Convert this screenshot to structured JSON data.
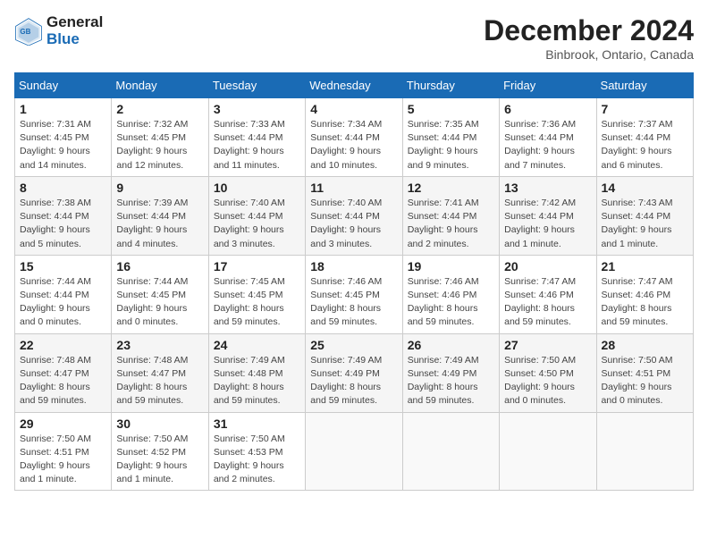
{
  "header": {
    "logo_line1": "General",
    "logo_line2": "Blue",
    "month_title": "December 2024",
    "location": "Binbrook, Ontario, Canada"
  },
  "days_of_week": [
    "Sunday",
    "Monday",
    "Tuesday",
    "Wednesday",
    "Thursday",
    "Friday",
    "Saturday"
  ],
  "weeks": [
    [
      {
        "day": "1",
        "info": "Sunrise: 7:31 AM\nSunset: 4:45 PM\nDaylight: 9 hours and 14 minutes."
      },
      {
        "day": "2",
        "info": "Sunrise: 7:32 AM\nSunset: 4:45 PM\nDaylight: 9 hours and 12 minutes."
      },
      {
        "day": "3",
        "info": "Sunrise: 7:33 AM\nSunset: 4:44 PM\nDaylight: 9 hours and 11 minutes."
      },
      {
        "day": "4",
        "info": "Sunrise: 7:34 AM\nSunset: 4:44 PM\nDaylight: 9 hours and 10 minutes."
      },
      {
        "day": "5",
        "info": "Sunrise: 7:35 AM\nSunset: 4:44 PM\nDaylight: 9 hours and 9 minutes."
      },
      {
        "day": "6",
        "info": "Sunrise: 7:36 AM\nSunset: 4:44 PM\nDaylight: 9 hours and 7 minutes."
      },
      {
        "day": "7",
        "info": "Sunrise: 7:37 AM\nSunset: 4:44 PM\nDaylight: 9 hours and 6 minutes."
      }
    ],
    [
      {
        "day": "8",
        "info": "Sunrise: 7:38 AM\nSunset: 4:44 PM\nDaylight: 9 hours and 5 minutes."
      },
      {
        "day": "9",
        "info": "Sunrise: 7:39 AM\nSunset: 4:44 PM\nDaylight: 9 hours and 4 minutes."
      },
      {
        "day": "10",
        "info": "Sunrise: 7:40 AM\nSunset: 4:44 PM\nDaylight: 9 hours and 3 minutes."
      },
      {
        "day": "11",
        "info": "Sunrise: 7:40 AM\nSunset: 4:44 PM\nDaylight: 9 hours and 3 minutes."
      },
      {
        "day": "12",
        "info": "Sunrise: 7:41 AM\nSunset: 4:44 PM\nDaylight: 9 hours and 2 minutes."
      },
      {
        "day": "13",
        "info": "Sunrise: 7:42 AM\nSunset: 4:44 PM\nDaylight: 9 hours and 1 minute."
      },
      {
        "day": "14",
        "info": "Sunrise: 7:43 AM\nSunset: 4:44 PM\nDaylight: 9 hours and 1 minute."
      }
    ],
    [
      {
        "day": "15",
        "info": "Sunrise: 7:44 AM\nSunset: 4:44 PM\nDaylight: 9 hours and 0 minutes."
      },
      {
        "day": "16",
        "info": "Sunrise: 7:44 AM\nSunset: 4:45 PM\nDaylight: 9 hours and 0 minutes."
      },
      {
        "day": "17",
        "info": "Sunrise: 7:45 AM\nSunset: 4:45 PM\nDaylight: 8 hours and 59 minutes."
      },
      {
        "day": "18",
        "info": "Sunrise: 7:46 AM\nSunset: 4:45 PM\nDaylight: 8 hours and 59 minutes."
      },
      {
        "day": "19",
        "info": "Sunrise: 7:46 AM\nSunset: 4:46 PM\nDaylight: 8 hours and 59 minutes."
      },
      {
        "day": "20",
        "info": "Sunrise: 7:47 AM\nSunset: 4:46 PM\nDaylight: 8 hours and 59 minutes."
      },
      {
        "day": "21",
        "info": "Sunrise: 7:47 AM\nSunset: 4:46 PM\nDaylight: 8 hours and 59 minutes."
      }
    ],
    [
      {
        "day": "22",
        "info": "Sunrise: 7:48 AM\nSunset: 4:47 PM\nDaylight: 8 hours and 59 minutes."
      },
      {
        "day": "23",
        "info": "Sunrise: 7:48 AM\nSunset: 4:47 PM\nDaylight: 8 hours and 59 minutes."
      },
      {
        "day": "24",
        "info": "Sunrise: 7:49 AM\nSunset: 4:48 PM\nDaylight: 8 hours and 59 minutes."
      },
      {
        "day": "25",
        "info": "Sunrise: 7:49 AM\nSunset: 4:49 PM\nDaylight: 8 hours and 59 minutes."
      },
      {
        "day": "26",
        "info": "Sunrise: 7:49 AM\nSunset: 4:49 PM\nDaylight: 8 hours and 59 minutes."
      },
      {
        "day": "27",
        "info": "Sunrise: 7:50 AM\nSunset: 4:50 PM\nDaylight: 9 hours and 0 minutes."
      },
      {
        "day": "28",
        "info": "Sunrise: 7:50 AM\nSunset: 4:51 PM\nDaylight: 9 hours and 0 minutes."
      }
    ],
    [
      {
        "day": "29",
        "info": "Sunrise: 7:50 AM\nSunset: 4:51 PM\nDaylight: 9 hours and 1 minute."
      },
      {
        "day": "30",
        "info": "Sunrise: 7:50 AM\nSunset: 4:52 PM\nDaylight: 9 hours and 1 minute."
      },
      {
        "day": "31",
        "info": "Sunrise: 7:50 AM\nSunset: 4:53 PM\nDaylight: 9 hours and 2 minutes."
      },
      null,
      null,
      null,
      null
    ]
  ]
}
